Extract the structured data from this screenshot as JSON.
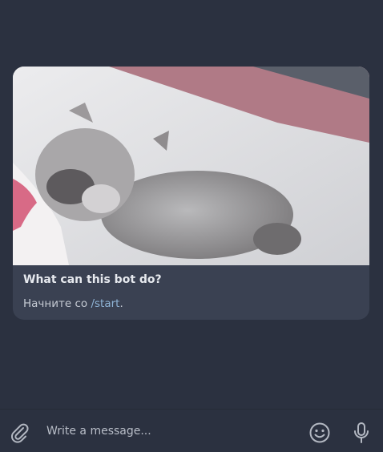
{
  "bot_card": {
    "title": "What can this bot do?",
    "description_prefix": "Начните со ",
    "description_command": "/start",
    "description_suffix": "."
  },
  "composer": {
    "placeholder": "Write a message..."
  },
  "icons": {
    "attach": "paperclip-icon",
    "emoji": "smile-icon",
    "voice": "microphone-icon"
  },
  "colors": {
    "background": "#2b3140",
    "card": "#3a4152",
    "link": "#8fb4d6"
  }
}
